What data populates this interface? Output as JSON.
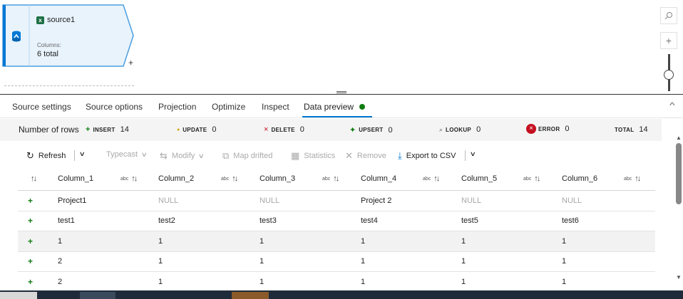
{
  "source_node": {
    "title": "source1",
    "columns_label": "Columns:",
    "columns_value": "6 total",
    "add_label": "+"
  },
  "zoom": {
    "search_icon": "search-icon",
    "zoom_in_label": "+",
    "level": 0.5
  },
  "tabs": [
    {
      "label": "Source settings"
    },
    {
      "label": "Source options"
    },
    {
      "label": "Projection"
    },
    {
      "label": "Optimize"
    },
    {
      "label": "Inspect"
    },
    {
      "label": "Data preview",
      "active": true,
      "status_color": "#107c10"
    }
  ],
  "stats": {
    "rows_label": "Number of rows",
    "insert": {
      "label": "INSERT",
      "value": "14",
      "color": "#107c10"
    },
    "update": {
      "label": "UPDATE",
      "value": "0",
      "color": "#d4a017"
    },
    "delete": {
      "label": "DELETE",
      "value": "0",
      "color": "#c50f1f"
    },
    "upsert": {
      "label": "UPSERT",
      "value": "0",
      "color": "#107c10"
    },
    "lookup": {
      "label": "LOOKUP",
      "value": "0"
    },
    "error": {
      "label": "ERROR",
      "value": "0",
      "color": "#c50f1f"
    },
    "total": {
      "label": "TOTAL",
      "value": "14"
    }
  },
  "toolbar": {
    "refresh": "Refresh",
    "typecast": "Typecast",
    "modify": "Modify",
    "map_drifted": "Map drifted",
    "statistics": "Statistics",
    "remove": "Remove",
    "export": "Export to CSV"
  },
  "table": {
    "columns": [
      "Column_1",
      "Column_2",
      "Column_3",
      "Column_4",
      "Column_5",
      "Column_6"
    ],
    "type_label": "abc",
    "rows": [
      [
        "Project1",
        "NULL",
        "NULL",
        "Project 2",
        "NULL",
        "NULL"
      ],
      [
        "test1",
        "test2",
        "test3",
        "test4",
        "test5",
        "test6"
      ],
      [
        "1",
        "1",
        "1",
        "1",
        "1",
        "1"
      ],
      [
        "2",
        "1",
        "1",
        "1",
        "1",
        "1"
      ],
      [
        "2",
        "1",
        "1",
        "1",
        "1",
        "1"
      ]
    ],
    "selected_row": 2,
    "row_marker": "+"
  },
  "colors": {
    "accent": "#0078d4",
    "node_border": "#4a9ee0",
    "node_fill": "#e8f3fc"
  }
}
